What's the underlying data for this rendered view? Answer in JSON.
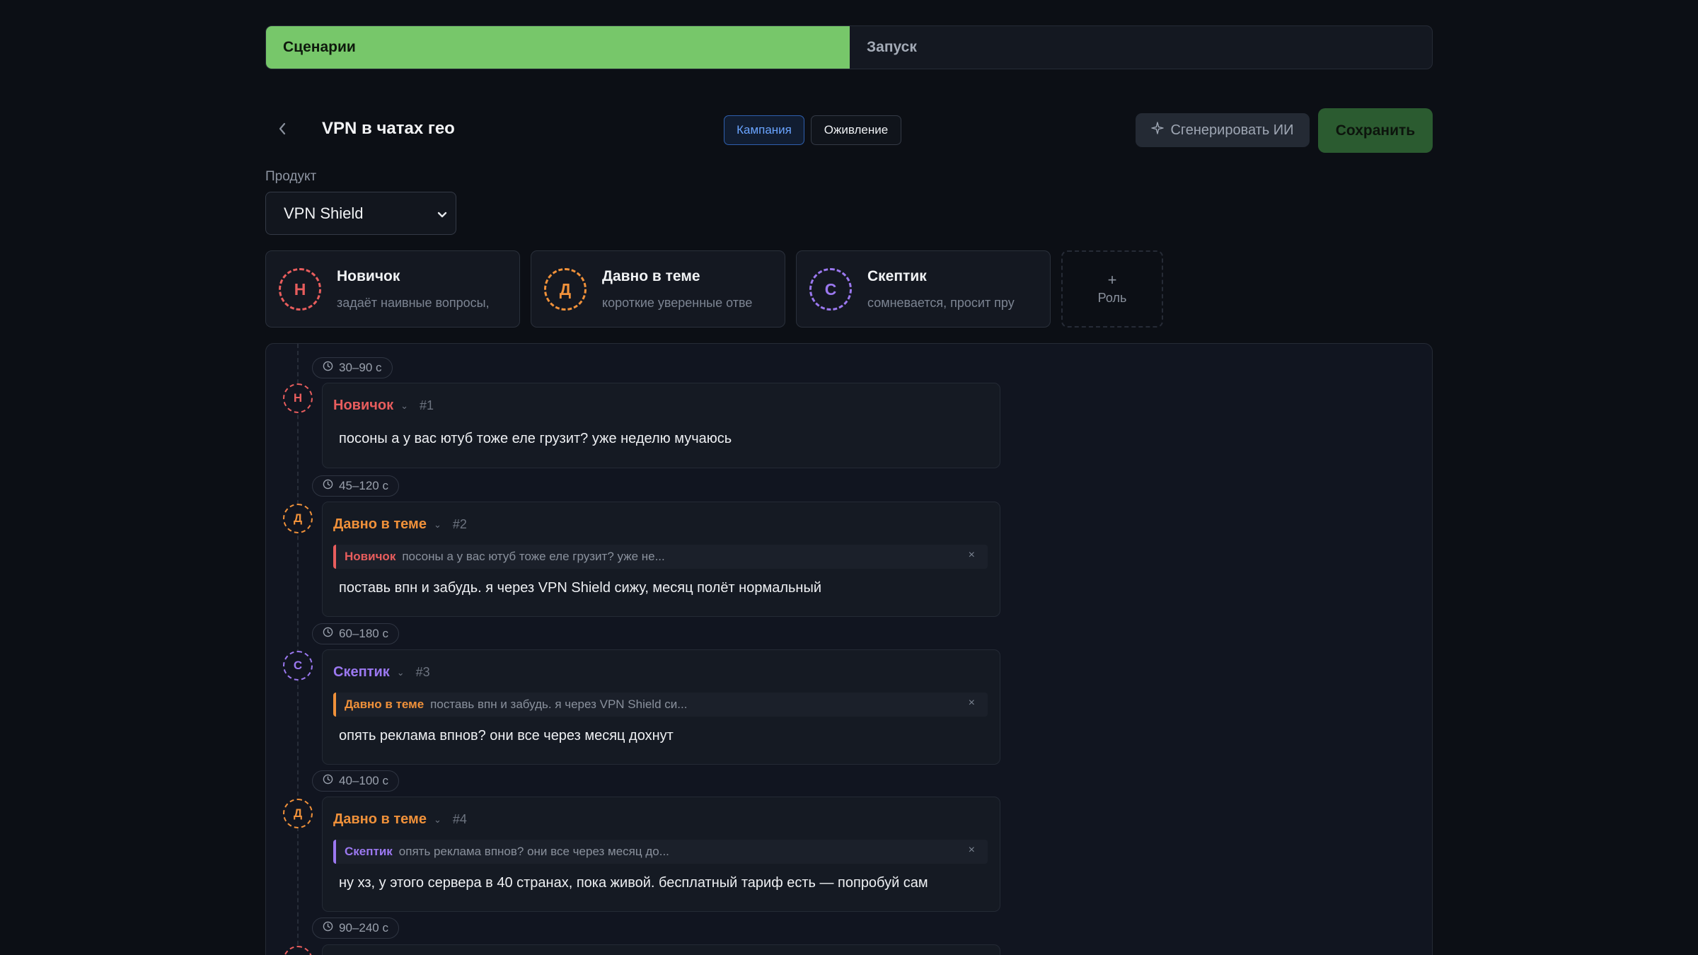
{
  "steps": {
    "active": "Сценарии",
    "inactive": "Запуск"
  },
  "header": {
    "title": "VPN в чатах гео",
    "modes": {
      "campaign": "Кампания",
      "revive": "Оживление"
    },
    "generate_label": "Сгенерировать ИИ",
    "save_label": "Сохранить"
  },
  "product": {
    "label": "Продукт",
    "value": "VPN Shield"
  },
  "roles": [
    {
      "letter": "Н",
      "name": "Новичок",
      "desc": "задаёт наивные вопросы,",
      "color": "#e85d5d"
    },
    {
      "letter": "Д",
      "name": "Давно в теме",
      "desc": "короткие уверенные отве",
      "color": "#f0913a"
    },
    {
      "letter": "С",
      "name": "Скептик",
      "desc": "сомневается, просит пру",
      "color": "#9b78f0"
    }
  ],
  "add_role_label": "Роль",
  "messages": [
    {
      "delay": "30–90 с",
      "letter": "Н",
      "role": "Новичок",
      "num": "#1",
      "color": "#e85d5d",
      "text": "посоны а у вас ютуб тоже еле грузит? уже неделю мучаюсь"
    },
    {
      "delay": "45–120 с",
      "letter": "Д",
      "role": "Давно в теме",
      "num": "#2",
      "color": "#f0913a",
      "quote_role": "Новичок",
      "quote_color": "#e85d5d",
      "quote_text": "посоны а у вас ютуб тоже еле грузит? уже не...",
      "text": "поставь впн и забудь. я через VPN Shield сижу, месяц полёт нормальный"
    },
    {
      "delay": "60–180 с",
      "letter": "С",
      "role": "Скептик",
      "num": "#3",
      "color": "#9b78f0",
      "quote_role": "Давно в теме",
      "quote_color": "#f0913a",
      "quote_text": "поставь впн и забудь. я через VPN Shield си...",
      "text": "опять реклама впнов? они все через месяц дохнут"
    },
    {
      "delay": "40–100 с",
      "letter": "Д",
      "role": "Давно в теме",
      "num": "#4",
      "color": "#f0913a",
      "quote_role": "Скептик",
      "quote_color": "#9b78f0",
      "quote_text": "опять реклама впнов? они все через месяц до...",
      "text": "ну хз, у этого сервера в 40 странах, пока живой. бесплатный тариф есть — попробуй сам"
    },
    {
      "delay": "90–240 с"
    }
  ],
  "colors": {
    "accent_green": "#77c76a",
    "save_green": "#2b5b30",
    "campaign_blue": "#6aa4ff"
  }
}
